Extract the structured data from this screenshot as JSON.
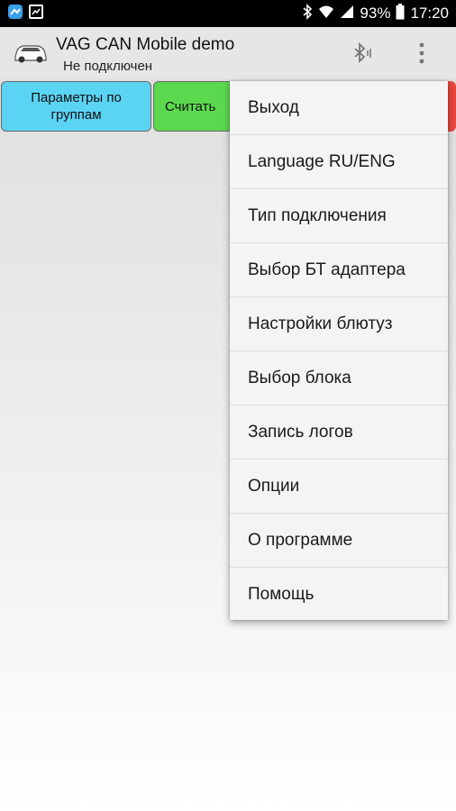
{
  "status_bar": {
    "battery": "93%",
    "time": "17:20",
    "icons": [
      "notification-app-icon",
      "gallery-icon",
      "bluetooth-icon",
      "wifi-icon",
      "signal-icon",
      "battery-icon"
    ]
  },
  "app_bar": {
    "title": "VAG CAN Mobile demo",
    "subtitle": "Не подключен",
    "icons": [
      "car-icon",
      "bluetooth-icon",
      "overflow-menu-icon"
    ]
  },
  "buttons": {
    "groups_label": "Параметры по группам",
    "read_label": "Считать"
  },
  "menu": {
    "items": [
      {
        "label": "Выход"
      },
      {
        "label": "Language RU/ENG"
      },
      {
        "label": "Тип подключения"
      },
      {
        "label": "Выбор БТ адаптера"
      },
      {
        "label": "Настройки блютуз"
      },
      {
        "label": "Выбор блока"
      },
      {
        "label": "Запись логов"
      },
      {
        "label": "Опции"
      },
      {
        "label": "О программе"
      },
      {
        "label": "Помощь"
      }
    ]
  },
  "colors": {
    "groups_button": "#5bd3f3",
    "read_button": "#5cd84f",
    "red_button": "#e8473c"
  }
}
